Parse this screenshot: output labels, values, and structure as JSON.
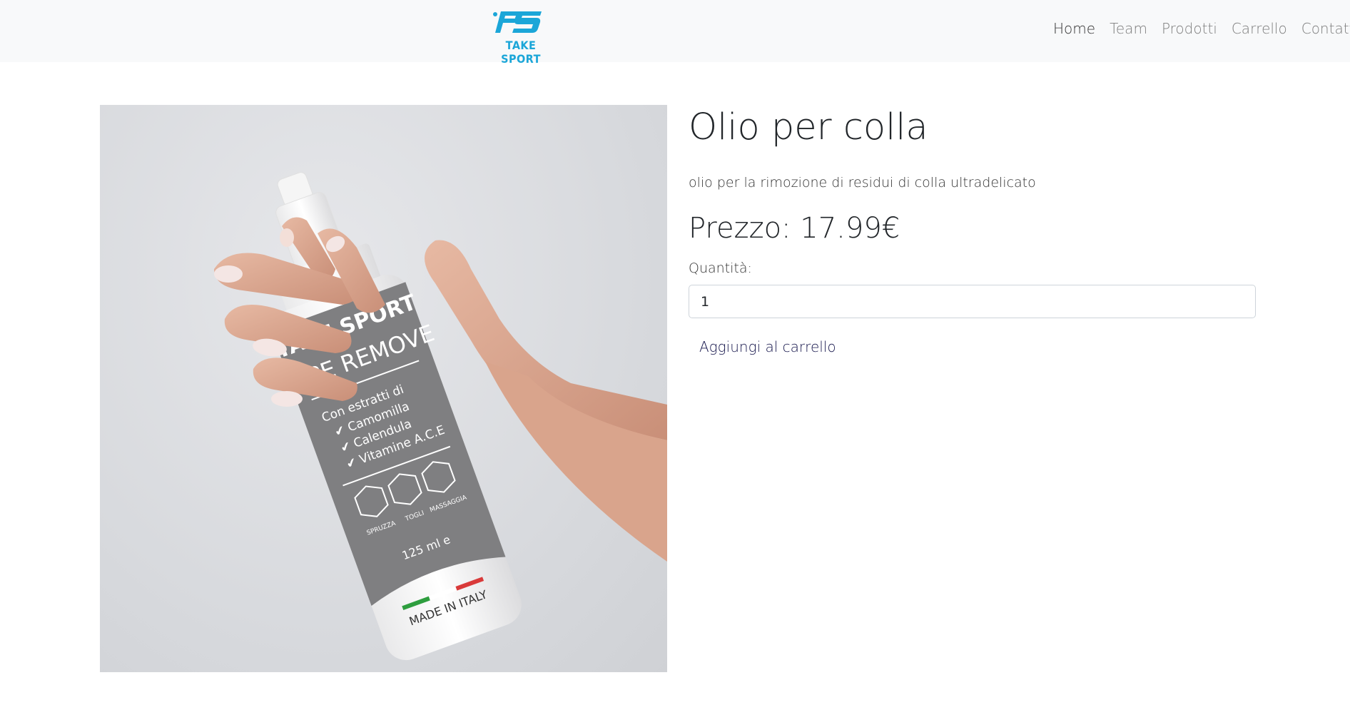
{
  "header": {
    "logo_text": "TAKE SPORT",
    "logo_mark": "TS",
    "brand_color": "#1ba6d8",
    "nav": [
      {
        "label": "Home",
        "active": true
      },
      {
        "label": "Team",
        "active": false
      },
      {
        "label": "Prodotti",
        "active": false
      },
      {
        "label": "Carrello",
        "active": false
      },
      {
        "label": "Contatti",
        "active": false
      }
    ]
  },
  "product": {
    "title": "Olio per colla",
    "description": "olio per la rimozione di residui di colla ultradelicato",
    "price": "Prezzo: 17.99€",
    "quantity_label": "Quantità:",
    "quantity_value": "1",
    "add_button": "Aggiungi al carrello",
    "image": {
      "bottle_brand": "TAKE SPORT",
      "bottle_product": "TAPE REMOVE",
      "bottle_text_1": "Con estratti di",
      "bottle_text_2": "✔ Camomilla",
      "bottle_text_3": "✔ Calendula",
      "bottle_text_4": "✔ Vitamine A.C.E",
      "bottle_icon_1": "SPRUZZA",
      "bottle_icon_2": "TOGLI",
      "bottle_icon_3": "MASSAGGIA",
      "bottle_volume": "125 ml e",
      "bottle_origin": "MADE IN ITALY"
    }
  }
}
